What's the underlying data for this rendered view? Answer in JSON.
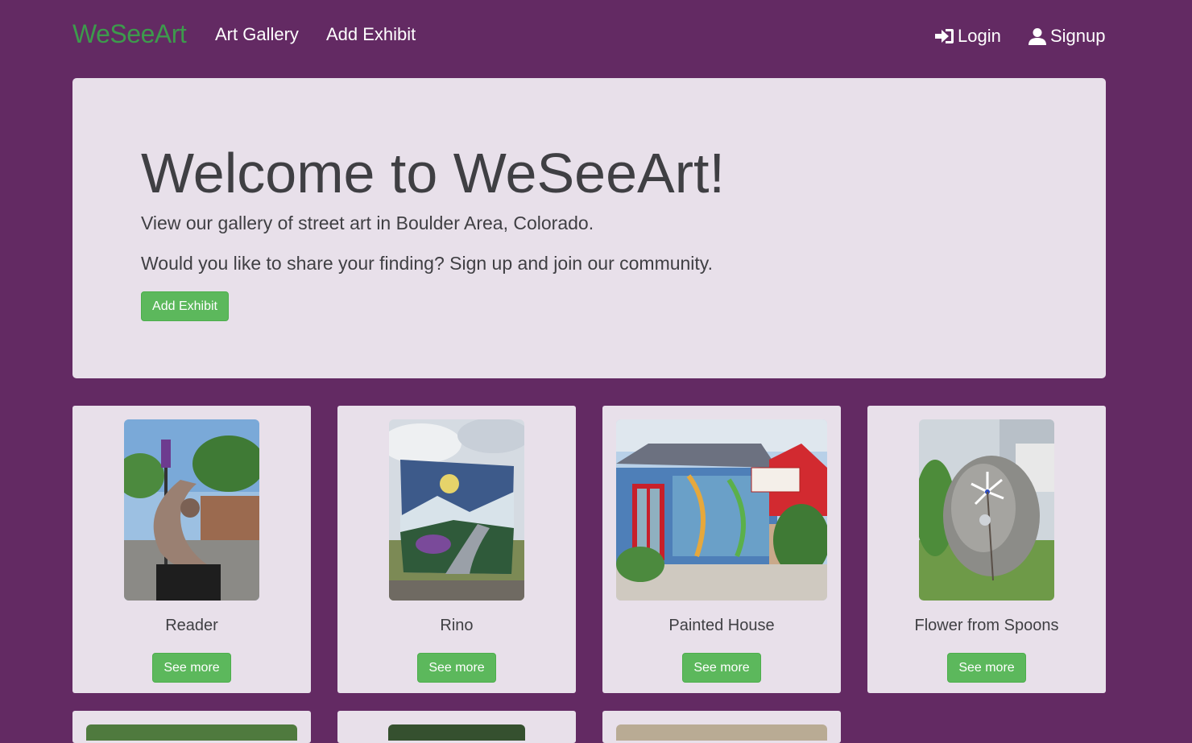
{
  "nav": {
    "brand": "WeSeeArt",
    "links": [
      "Art Gallery",
      "Add Exhibit"
    ],
    "login_label": "Login",
    "signup_label": "Signup",
    "login_icon": "login-icon",
    "signup_icon": "user-icon"
  },
  "hero": {
    "title": "Welcome to WeSeeArt!",
    "line1": "View our gallery of street art in Boulder Area, Colorado.",
    "line2": "Would you like to share your finding? Sign up and join our community.",
    "button_label": "Add Exhibit"
  },
  "cards": [
    {
      "title": "Reader",
      "button_label": "See more"
    },
    {
      "title": "Rino",
      "button_label": "See more"
    },
    {
      "title": "Painted House",
      "button_label": "See more"
    },
    {
      "title": "Flower from Spoons",
      "button_label": "See more"
    }
  ],
  "colors": {
    "background": "#632a63",
    "panel": "#e8e0ea",
    "brand": "#3d9a4c",
    "button": "#5cb85c",
    "text": "#3f3f43"
  }
}
